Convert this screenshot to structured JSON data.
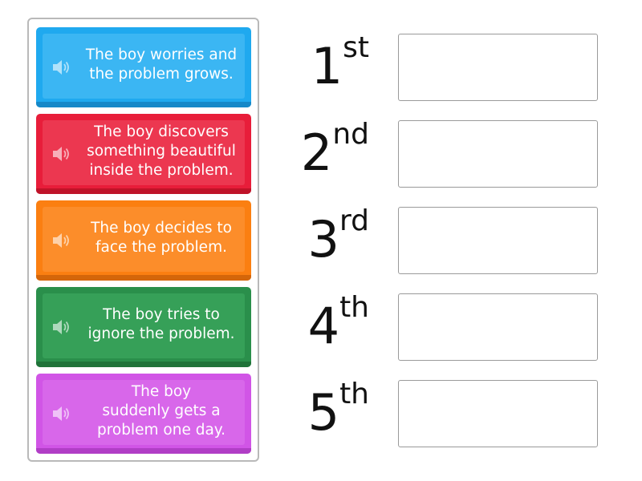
{
  "tiles": [
    {
      "label": "The boy worries and\nthe problem grows.",
      "icon": "speaker-icon",
      "color": "#1fa9ef",
      "inner": "#3bb6f3",
      "shade": "#1688c8"
    },
    {
      "label": "The boy discovers\nsomething beautiful\ninside the problem.",
      "icon": "speaker-icon",
      "color": "#e81d3a",
      "inner": "#ec3750",
      "shade": "#bf1329"
    },
    {
      "label": "The boy decides to\nface the problem.",
      "icon": "speaker-icon",
      "color": "#fb7f11",
      "inner": "#fc8d2a",
      "shade": "#d4660a"
    },
    {
      "label": "The boy tries to\nignore the problem.",
      "icon": "speaker-icon",
      "color": "#2a8f4b",
      "inner": "#36a058",
      "shade": "#207339"
    },
    {
      "label": "The boy\nsuddenly gets a\nproblem one day.",
      "icon": "speaker-icon",
      "color": "#d155e6",
      "inner": "#d867ea",
      "shade": "#b13ec6"
    }
  ],
  "ordinals": [
    {
      "num": "1",
      "suffix": "st"
    },
    {
      "num": "2",
      "suffix": "nd"
    },
    {
      "num": "3",
      "suffix": "rd"
    },
    {
      "num": "4",
      "suffix": "th"
    },
    {
      "num": "5",
      "suffix": "th"
    }
  ]
}
